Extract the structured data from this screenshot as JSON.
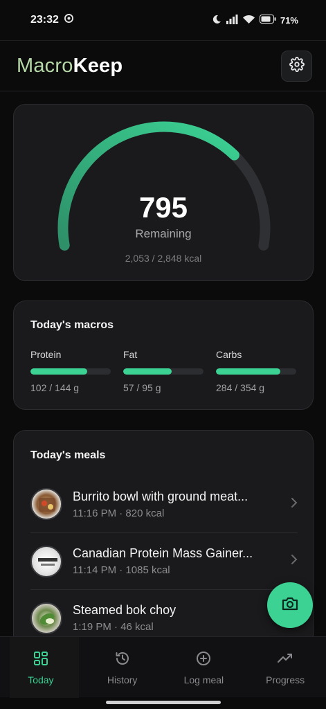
{
  "status": {
    "time": "23:32",
    "battery": "71%"
  },
  "header": {
    "logo_part1": "Macro",
    "logo_part2": "Keep"
  },
  "summary": {
    "remaining": "795",
    "remaining_label": "Remaining",
    "kcal_text": "2,053 / 2,848 kcal",
    "consumed_fraction": 0.72
  },
  "macros": {
    "title": "Today's macros",
    "items": [
      {
        "name": "Protein",
        "amount": "102 / 144 g",
        "fraction": 0.71
      },
      {
        "name": "Fat",
        "amount": "57 / 95 g",
        "fraction": 0.6
      },
      {
        "name": "Carbs",
        "amount": "284 / 354 g",
        "fraction": 0.8
      }
    ]
  },
  "meals": {
    "title": "Today's meals",
    "items": [
      {
        "name": "Burrito bowl with ground meat...",
        "meta": "11:16 PM · 820 kcal"
      },
      {
        "name": "Canadian Protein Mass Gainer...",
        "meta": "11:14 PM · 1085 kcal"
      },
      {
        "name": "Steamed bok choy",
        "meta": "1:19 PM · 46 kcal"
      }
    ]
  },
  "nav": {
    "items": [
      {
        "label": "Today"
      },
      {
        "label": "History"
      },
      {
        "label": "Log meal"
      },
      {
        "label": "Progress"
      }
    ]
  },
  "colors": {
    "accent": "#3bd294",
    "background": "#0b0b0c",
    "card": "#1a1a1c"
  },
  "icons": [
    "settings-gear-icon",
    "camera-icon",
    "grid-icon",
    "history-icon",
    "plus-circle-icon",
    "trending-up-icon",
    "chevron-right-icon"
  ]
}
